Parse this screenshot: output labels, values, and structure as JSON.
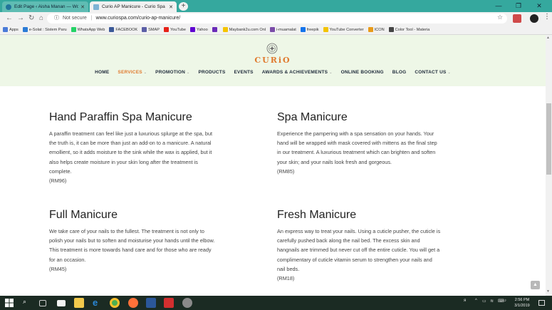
{
  "browser": {
    "tabs": [
      {
        "title": "Edit Page ‹ Aisha Manan — Wo",
        "icon": "wordpress-icon",
        "color": "#21759b"
      },
      {
        "title": "Curio AP Manicure - Curio Spa",
        "icon": "curio-favicon",
        "color": "#7fb3d5"
      }
    ],
    "address": {
      "security": "Not secure",
      "url": "www.curiospa.com/curio-ap-manicure/"
    },
    "bookmarks": [
      {
        "label": "Apps",
        "color": "#4a7ad8"
      },
      {
        "label": "e-Solat : Sistem Paru",
        "color": "#2b7bd6"
      },
      {
        "label": "WhatsApp Web",
        "color": "#25d366"
      },
      {
        "label": "FACEBOOK",
        "color": "#3b5998"
      },
      {
        "label": "SMAP",
        "color": "#5b5ea6"
      },
      {
        "label": "YouTube",
        "color": "#e62117"
      },
      {
        "label": "Yahoo",
        "color": "#5f01d1"
      },
      {
        "label": "",
        "color": "#6a2bb8"
      },
      {
        "label": "Maybank2u.com Onl",
        "color": "#f5c400"
      },
      {
        "label": "i-muamalat",
        "color": "#7a4ba8"
      },
      {
        "label": "freepik",
        "color": "#1273eb"
      },
      {
        "label": "YouTube Converter",
        "color": "#f2c300"
      },
      {
        "label": "ICON",
        "color": "#e89b1a"
      },
      {
        "label": "Color Tool - Materia",
        "color": "#444444"
      }
    ]
  },
  "site": {
    "logo_text": "CURiO",
    "nav": [
      {
        "label": "HOME",
        "active": false,
        "dropdown": false
      },
      {
        "label": "SERVICES",
        "active": true,
        "dropdown": true
      },
      {
        "label": "PROMOTION",
        "active": false,
        "dropdown": true
      },
      {
        "label": "PRODUCTS",
        "active": false,
        "dropdown": false
      },
      {
        "label": "EVENTS",
        "active": false,
        "dropdown": false
      },
      {
        "label": "AWARDS & ACHIEVEMENTS",
        "active": false,
        "dropdown": true
      },
      {
        "label": "ONLINE BOOKING",
        "active": false,
        "dropdown": false
      },
      {
        "label": "BLOG",
        "active": false,
        "dropdown": false
      },
      {
        "label": "CONTACT US",
        "active": false,
        "dropdown": true
      }
    ],
    "cards": [
      {
        "title": "Hand Paraffin Spa Manicure",
        "description": "A paraffin treatment can feel like just a luxurious splurge at the spa, but the truth is, it can be more than just an add-on to a manicure. A natural emollient, so it adds moisture to the sink while the wax is applied, but it also helps create moisture in your skin long after the treatment is complete.",
        "price": "(RM96)"
      },
      {
        "title": "Spa Manicure",
        "description": "Experience the pampering with a spa sensation on your hands. Your hand will be wrapped with mask covered with mittens as the final step in our treatment. A luxurious treatment which can brighten and soften your skin; and your nails look fresh and gorgeous.",
        "price": "(RM85)"
      },
      {
        "title": "Full Manicure",
        "description": "We take care of your nails to the fullest. The treatment is not only to polish your nails but to soften and moisturise your hands until the elbow. This treatment is more towards hand care and for those who are ready for an occasion.",
        "price": "(RM45)"
      },
      {
        "title": "Fresh Manicure",
        "description": "An express way to treat your nails. Using a cuticle pusher, the cuticle is carefully pushed back along the nail bed. The excess skin and hangnails are trimmed but never cut off the entire cuticle. You will get a complimentary of cuticle vitamin serum to strengthen your nails and nail beds.",
        "price": "(RM18)"
      }
    ]
  },
  "taskbar": {
    "clock_time": "2:56 PM",
    "clock_date": "3/1/2019"
  }
}
